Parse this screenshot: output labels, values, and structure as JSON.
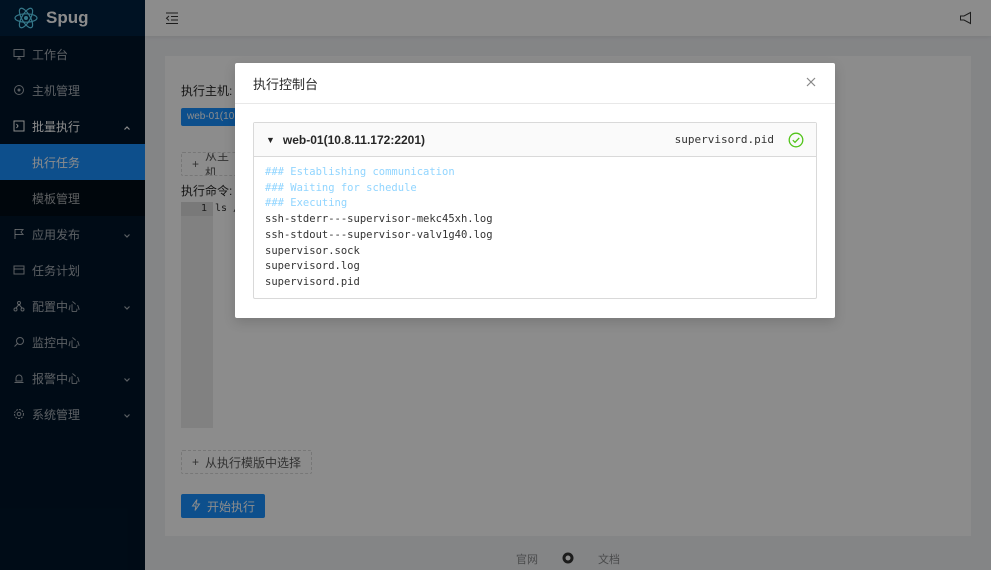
{
  "app": {
    "name": "Spug"
  },
  "sidebar": {
    "items": [
      {
        "label": "工作台",
        "icon": "desktop-icon"
      },
      {
        "label": "主机管理",
        "icon": "cloud-server-icon"
      },
      {
        "label": "批量执行",
        "icon": "code-icon",
        "expanded": true
      },
      {
        "label": "执行任务",
        "sub": true,
        "active": true
      },
      {
        "label": "模板管理",
        "sub": true
      },
      {
        "label": "应用发布",
        "icon": "flag-icon"
      },
      {
        "label": "任务计划",
        "icon": "schedule-icon"
      },
      {
        "label": "配置中心",
        "icon": "deployment-icon"
      },
      {
        "label": "监控中心",
        "icon": "monitor-icon"
      },
      {
        "label": "报警中心",
        "icon": "alert-icon"
      },
      {
        "label": "系统管理",
        "icon": "setting-icon"
      }
    ]
  },
  "form": {
    "host_label": "执行主机:",
    "host_tag": "web-01(10.8.11.172:2201)",
    "add_host_button": "从主机",
    "command_label": "执行命令:",
    "editor_line_no": "1",
    "editor_code": "ls /",
    "template_button": "从执行模版中选择",
    "start_button": "开始执行"
  },
  "footer": {
    "site_link": "官网",
    "docs_link": "文档"
  },
  "modal": {
    "title": "执行控制台",
    "panel": {
      "host": "web-01(10.8.11.172:2201)",
      "last_line": "supervisord.pid",
      "status": "success",
      "lines": [
        {
          "text": "### Establishing communication",
          "kind": "sys"
        },
        {
          "text": "### Waiting for schedule",
          "kind": "sys"
        },
        {
          "text": "### Executing",
          "kind": "sys"
        },
        {
          "text": "ssh-stderr---supervisor-mekc45xh.log",
          "kind": "out"
        },
        {
          "text": "ssh-stdout---supervisor-valv1g40.log",
          "kind": "out"
        },
        {
          "text": "supervisor.sock",
          "kind": "out"
        },
        {
          "text": "supervisord.log",
          "kind": "out"
        },
        {
          "text": "supervisord.pid",
          "kind": "out"
        }
      ]
    }
  },
  "colors": {
    "primary": "#1890ff",
    "sidebar": "#001529",
    "success": "#52c41a",
    "log_system": "#91d5ff"
  }
}
